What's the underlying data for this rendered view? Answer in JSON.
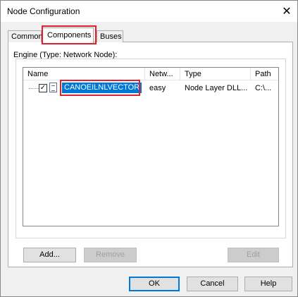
{
  "window": {
    "title": "Node Configuration"
  },
  "tabs": [
    {
      "label": "Common"
    },
    {
      "label": "Components",
      "selected": true
    },
    {
      "label": "Buses"
    }
  ],
  "engine_label": "Engine (Type: Network Node):",
  "table": {
    "columns": [
      "Name",
      "Netw...",
      "Type",
      "Path"
    ],
    "rows": [
      {
        "checked": true,
        "name": "CANOEILNLVECTOR",
        "netw": "easy",
        "type": "Node Layer DLL...",
        "path": "C:\\..."
      }
    ]
  },
  "buttons": {
    "add": "Add...",
    "remove": "Remove",
    "edit": "Edit",
    "ok": "OK",
    "cancel": "Cancel",
    "help": "Help"
  },
  "icons": {
    "close": "close-icon",
    "checkbox": "checkbox-icon",
    "file": "file-icon"
  },
  "colors": {
    "selection": "#0078d7",
    "highlight": "#e0202e"
  }
}
